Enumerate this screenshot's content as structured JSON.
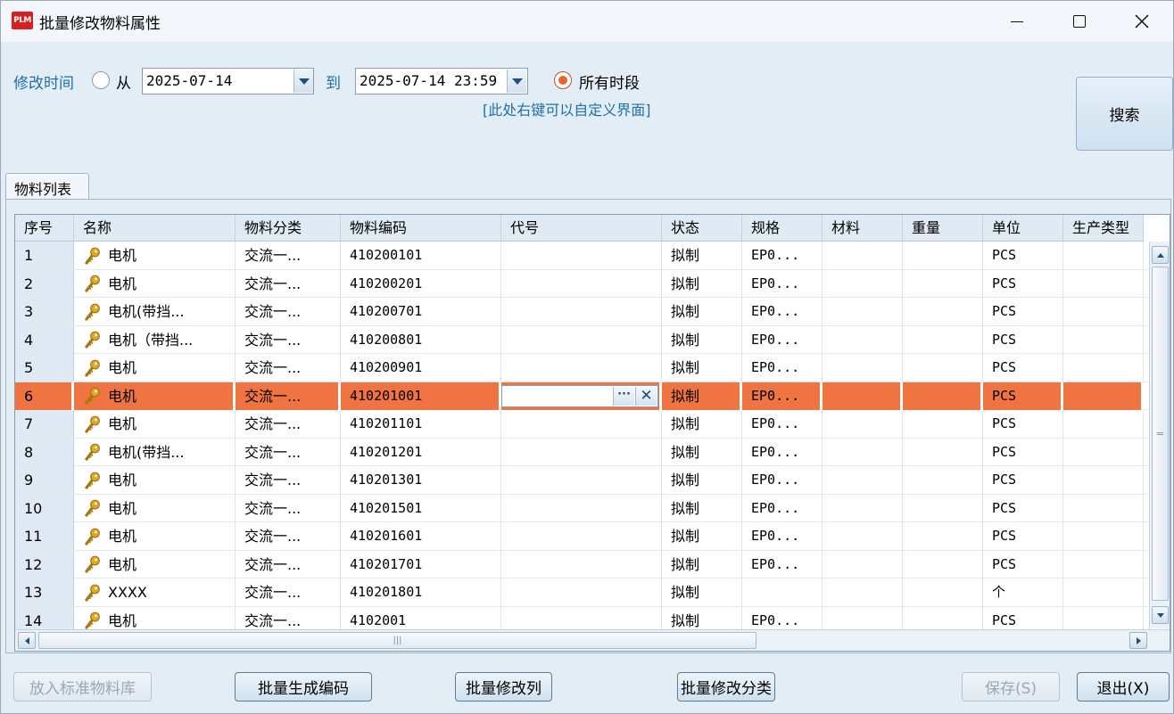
{
  "window": {
    "logo_text": "PLM",
    "title": "批量修改物料属性"
  },
  "filter": {
    "modify_time_label": "修改时间",
    "from_label": "从",
    "from_date": "2025-07-14",
    "to_label": "到",
    "to_date": "2025-07-14 23:59",
    "all_time_label": "所有时段",
    "all_time_checked": true,
    "customize_hint": "[此处右键可以自定义界面]",
    "search_label": "搜索"
  },
  "tab": {
    "label": "物料列表"
  },
  "grid": {
    "columns": [
      "序号",
      "名称",
      "物料分类",
      "物料编码",
      "代号",
      "状态",
      "规格",
      "材料",
      "重量",
      "单位",
      "生产类型"
    ],
    "selected_row_index": 5,
    "rows": [
      {
        "seq": "1",
        "name": "电机",
        "category": "交流一...",
        "code": "410200101",
        "alias": "",
        "status": "拟制",
        "spec": "EP0...",
        "material": "",
        "weight": "",
        "unit": "PCS",
        "prod_type": ""
      },
      {
        "seq": "2",
        "name": "电机",
        "category": "交流一...",
        "code": "410200201",
        "alias": "",
        "status": "拟制",
        "spec": "EP0...",
        "material": "",
        "weight": "",
        "unit": "PCS",
        "prod_type": ""
      },
      {
        "seq": "3",
        "name": "电机(带挡...",
        "category": "交流一...",
        "code": "410200701",
        "alias": "",
        "status": "拟制",
        "spec": "EP0...",
        "material": "",
        "weight": "",
        "unit": "PCS",
        "prod_type": ""
      },
      {
        "seq": "4",
        "name": "电机（带挡...",
        "category": "交流一...",
        "code": "410200801",
        "alias": "",
        "status": "拟制",
        "spec": "EP0...",
        "material": "",
        "weight": "",
        "unit": "PCS",
        "prod_type": ""
      },
      {
        "seq": "5",
        "name": "电机",
        "category": "交流一...",
        "code": "410200901",
        "alias": "",
        "status": "拟制",
        "spec": "EP0...",
        "material": "",
        "weight": "",
        "unit": "PCS",
        "prod_type": ""
      },
      {
        "seq": "6",
        "name": "电机",
        "category": "交流一...",
        "code": "410201001",
        "alias": "",
        "status": "拟制",
        "spec": "EP0...",
        "material": "",
        "weight": "",
        "unit": "PCS",
        "prod_type": ""
      },
      {
        "seq": "7",
        "name": "电机",
        "category": "交流一...",
        "code": "410201101",
        "alias": "",
        "status": "拟制",
        "spec": "EP0...",
        "material": "",
        "weight": "",
        "unit": "PCS",
        "prod_type": ""
      },
      {
        "seq": "8",
        "name": "电机(带挡...",
        "category": "交流一...",
        "code": "410201201",
        "alias": "",
        "status": "拟制",
        "spec": "EP0...",
        "material": "",
        "weight": "",
        "unit": "PCS",
        "prod_type": ""
      },
      {
        "seq": "9",
        "name": "电机",
        "category": "交流一...",
        "code": "410201301",
        "alias": "",
        "status": "拟制",
        "spec": "EP0...",
        "material": "",
        "weight": "",
        "unit": "PCS",
        "prod_type": ""
      },
      {
        "seq": "10",
        "name": "电机",
        "category": "交流一...",
        "code": "410201501",
        "alias": "",
        "status": "拟制",
        "spec": "EP0...",
        "material": "",
        "weight": "",
        "unit": "PCS",
        "prod_type": ""
      },
      {
        "seq": "11",
        "name": "电机",
        "category": "交流一...",
        "code": "410201601",
        "alias": "",
        "status": "拟制",
        "spec": "EP0...",
        "material": "",
        "weight": "",
        "unit": "PCS",
        "prod_type": ""
      },
      {
        "seq": "12",
        "name": "电机",
        "category": "交流一...",
        "code": "410201701",
        "alias": "",
        "status": "拟制",
        "spec": "EP0...",
        "material": "",
        "weight": "",
        "unit": "PCS",
        "prod_type": ""
      },
      {
        "seq": "13",
        "name": "XXXX",
        "category": "交流一...",
        "code": "410201801",
        "alias": "",
        "status": "拟制",
        "spec": "",
        "material": "",
        "weight": "",
        "unit": "个",
        "prod_type": ""
      },
      {
        "seq": "14",
        "name": "电机",
        "category": "交流一...",
        "code": "4102001",
        "alias": "",
        "status": "拟制",
        "spec": "EP0...",
        "material": "",
        "weight": "",
        "unit": "PCS",
        "prod_type": ""
      }
    ]
  },
  "buttons": {
    "add_to_library": "放入标准物料库",
    "batch_gen_code": "批量生成编码",
    "batch_modify_column": "批量修改列",
    "batch_modify_category": "批量修改分类",
    "save": "保存(S)",
    "exit": "退出(X)"
  },
  "icons": {
    "item_icon": "material-key-icon",
    "close": "close-icon",
    "maximize": "maximize-icon",
    "minimize": "minimize-icon"
  },
  "colors": {
    "selection": "#ef7441",
    "accent_blue": "#1f6fa8",
    "radio_checked": "#e8652f"
  }
}
